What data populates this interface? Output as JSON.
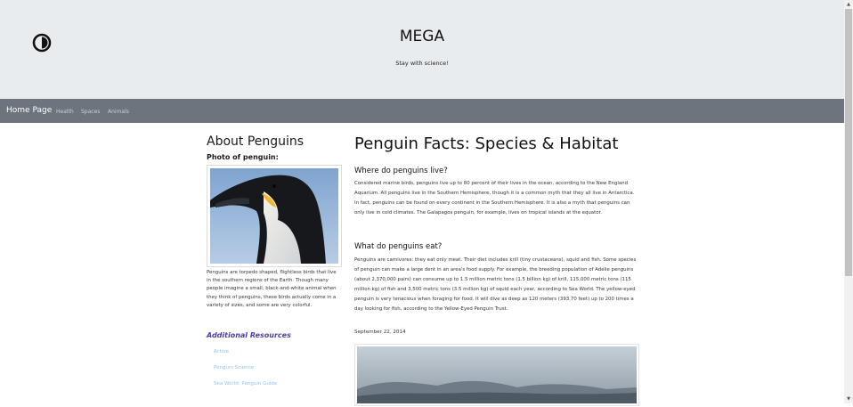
{
  "header": {
    "logo_icon": "half-circle-logo-icon",
    "title": "MEGA",
    "tagline": "Stay with science!"
  },
  "navbar": {
    "brand": "Home Page",
    "links": [
      "Health",
      "Spaces",
      "Animals"
    ]
  },
  "sidebar": {
    "title": "About Penguins",
    "photo_label": "Photo of penguin:",
    "description": "Penguins are torpedo shaped, flightless birds that live in the southern regions of the Earth. Though many people imagine a small, black-and-white animal when they think of penguins, these birds actually come in a variety of sizes, and some are very colorful.",
    "resources_title": "Additional Resources",
    "resources": [
      "Active",
      "Penguin Science",
      "Sea World: Penguin Guide"
    ]
  },
  "main": {
    "title": "Penguin Facts: Species & Habitat",
    "sections": [
      {
        "heading": "Where do penguins live?",
        "text": "Considered marine birds, penguins live up to 80 percent of their lives in the ocean, according to the New England Aquarium. All penguins live in the Southern Hemisphere, though it is a common myth that they all live in Antarctica. In fact, penguins can be found on every continent in the Southern Hemisphere. It is also a myth that penguins can only live in cold climates. The Galapagos penguin, for example, lives on tropical islands at the equator."
      },
      {
        "heading": "What do penguins eat?",
        "text": "Penguins are carnivores: they eat only meat. Their diet includes krill (tiny crustaceans), squid and fish. Some species of penguin can make a large dent in an area's food supply. For example, the breeding population of Adélie penguins (about 2,370,000 pairs) can consume up to 1.5 million metric tons (1.5 billion kg) of krill, 115,000 metric tons (115 million kg) of fish and 3,500 metric tons (3.5 million kg) of squid each year, according to Sea World. The yellow-eyed penguin is very tenacious when foraging for food. It will dive as deep as 120 meters (393.70 feet) up to 200 times a day looking for fish, according to the Yellow-Eyed Penguin Trust."
      }
    ],
    "date": "September 22, 2014"
  },
  "colors": {
    "header_bg": "#e9ecef",
    "navbar_bg": "#6c757d",
    "resources_title": "#4b3fa3",
    "link": "#8fc3f0"
  }
}
